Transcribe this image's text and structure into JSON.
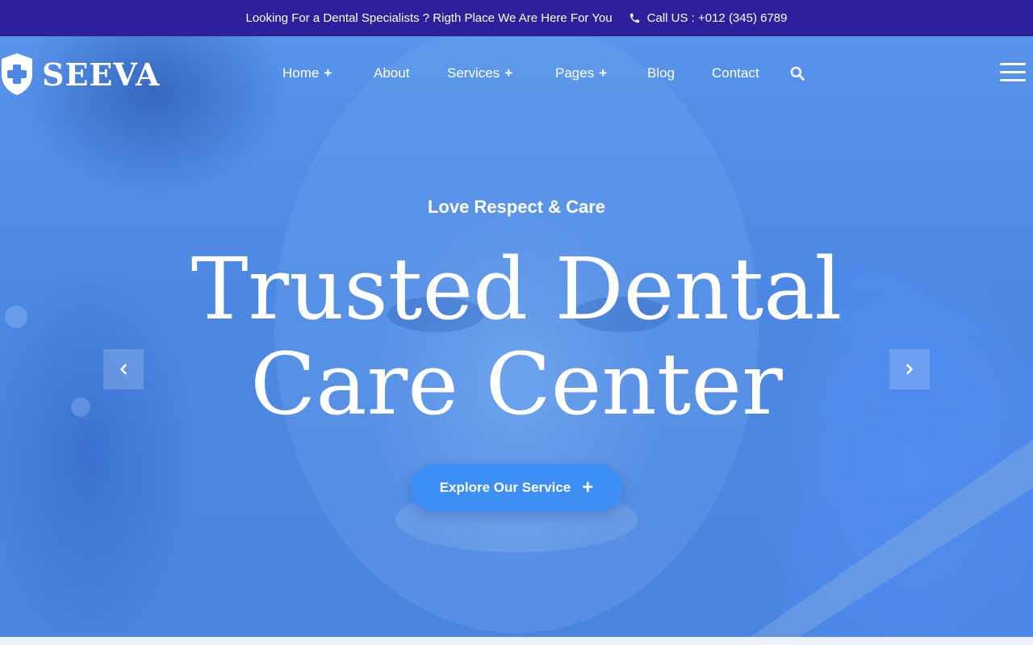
{
  "topbar": {
    "message": "Looking For a Dental Specialists ? Rigth Place We Are Here For You",
    "call": "Call US : +012 (345) 6789",
    "phone_icon": "phone-icon"
  },
  "logo": {
    "text": "SEEVA",
    "icon": "shield-cross-icon"
  },
  "nav": {
    "items": [
      {
        "label": "Home",
        "has_submenu": true
      },
      {
        "label": "About",
        "has_submenu": false
      },
      {
        "label": "Services",
        "has_submenu": true
      },
      {
        "label": "Pages",
        "has_submenu": true
      },
      {
        "label": "Blog",
        "has_submenu": false
      },
      {
        "label": "Contact",
        "has_submenu": false
      }
    ],
    "submenu_symbol": "+",
    "search_icon": "search-icon",
    "menu_icon": "hamburger-icon"
  },
  "hero": {
    "subtitle": "Love Respect & Care",
    "title_line1": "Trusted Dental",
    "title_line2": "Care Center",
    "cta_label": "Explore Our Service",
    "cta_symbol": "+",
    "prev_icon": "chevron-left-icon",
    "next_icon": "chevron-right-icon"
  },
  "colors": {
    "topbar": "#2e1f9c",
    "hero_overlay": "#4c88e3",
    "cta": "#3d8ff5",
    "text": "#ffffff"
  }
}
